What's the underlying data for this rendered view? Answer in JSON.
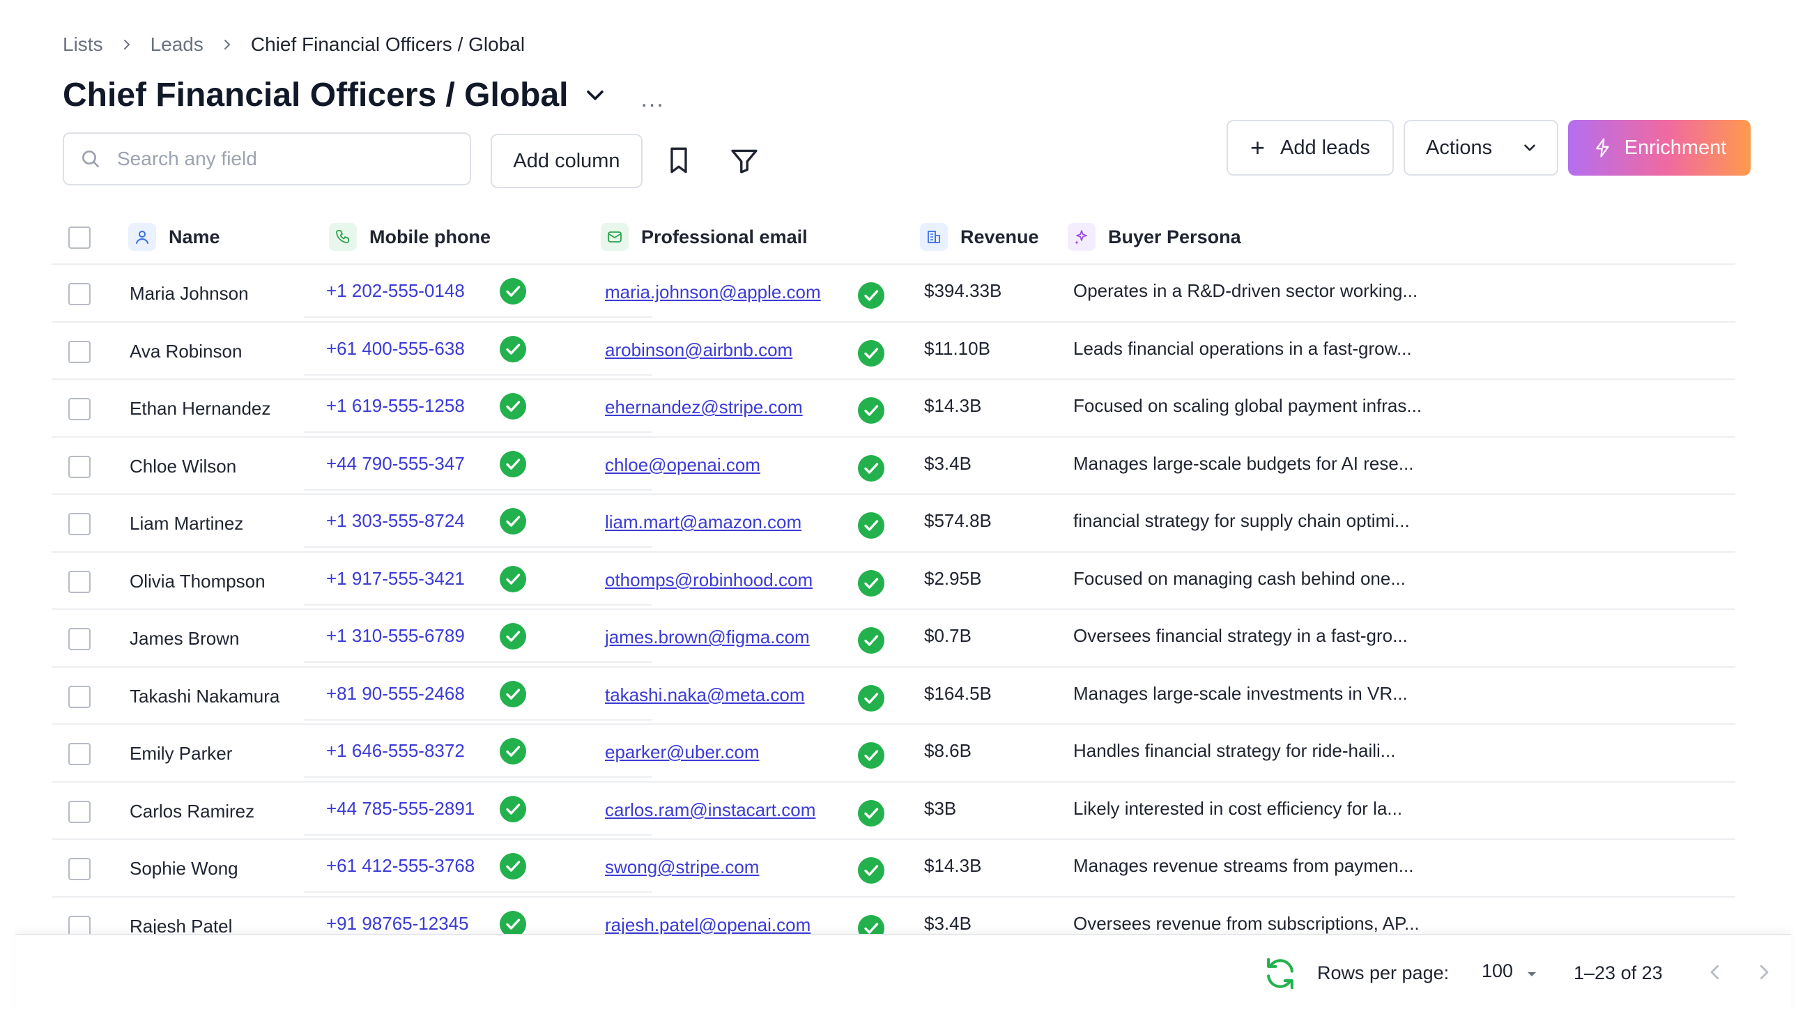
{
  "breadcrumb": [
    "Lists",
    "Leads",
    "Chief Financial Officers / Global"
  ],
  "page_title": "Chief Financial Officers / Global",
  "more_label": "...",
  "search": {
    "placeholder": "Search any field"
  },
  "toolbar": {
    "add_column": "Add column",
    "add_leads": "Add leads",
    "actions": "Actions",
    "enrichment": "Enrichment"
  },
  "columns": [
    "Name",
    "Mobile phone",
    "Professional email",
    "Revenue",
    "Buyer Persona"
  ],
  "rows": [
    {
      "name": "Maria Johnson",
      "phone": "+1 202-555-0148",
      "email": "maria.johnson@apple.com",
      "revenue": "$394.33B",
      "persona": "Operates in a R&D-driven sector working..."
    },
    {
      "name": "Ava Robinson",
      "phone": "+61 400-555-638",
      "email": "arobinson@airbnb.com",
      "revenue": "$11.10B",
      "persona": "Leads financial operations in a fast-grow..."
    },
    {
      "name": "Ethan Hernandez",
      "phone": "+1 619-555-1258",
      "email": "ehernandez@stripe.com",
      "revenue": "$14.3B",
      "persona": "Focused on scaling global payment infras..."
    },
    {
      "name": "Chloe Wilson",
      "phone": "+44 790-555-347",
      "email": "chloe@openai.com",
      "revenue": "$3.4B",
      "persona": "Manages large-scale budgets for AI rese..."
    },
    {
      "name": "Liam Martinez",
      "phone": "+1 303-555-8724",
      "email": "liam.mart@amazon.com",
      "revenue": "$574.8B",
      "persona": "financial strategy for supply chain optimi..."
    },
    {
      "name": "Olivia Thompson",
      "phone": "+1 917-555-3421",
      "email": "othomps@robinhood.com",
      "revenue": "$2.95B",
      "persona": "Focused on managing cash behind one..."
    },
    {
      "name": "James Brown",
      "phone": "+1 310-555-6789",
      "email": "james.brown@figma.com",
      "revenue": "$0.7B",
      "persona": "Oversees financial strategy in a fast-gro..."
    },
    {
      "name": "Takashi Nakamura",
      "phone": "+81 90-555-2468",
      "email": "takashi.naka@meta.com",
      "revenue": "$164.5B",
      "persona": "Manages large-scale investments in VR..."
    },
    {
      "name": "Emily Parker",
      "phone": "+1 646-555-8372",
      "email": "eparker@uber.com",
      "revenue": "$8.6B",
      "persona": "Handles financial strategy for ride-haili..."
    },
    {
      "name": "Carlos Ramirez",
      "phone": "+44 785-555-2891",
      "email": "carlos.ram@instacart.com",
      "revenue": "$3B",
      "persona": "Likely interested in cost efficiency for la..."
    },
    {
      "name": "Sophie Wong",
      "phone": "+61 412-555-3768",
      "email": "swong@stripe.com",
      "revenue": "$14.3B",
      "persona": "Manages revenue streams from paymen..."
    },
    {
      "name": "Rajesh Patel",
      "phone": "+91 98765-12345",
      "email": "rajesh.patel@openai.com",
      "revenue": "$3.4B",
      "persona": "Oversees revenue from subscriptions, AP..."
    }
  ],
  "pagination": {
    "rows_per_page_label": "Rows per page:",
    "rows_per_page": "100",
    "range": "1–23 of 23"
  },
  "colors": {
    "accent_link": "#3b3bd6",
    "verified_green": "#22b14c",
    "enrich_start": "#b46ef0",
    "enrich_end": "#ff9a4d"
  }
}
